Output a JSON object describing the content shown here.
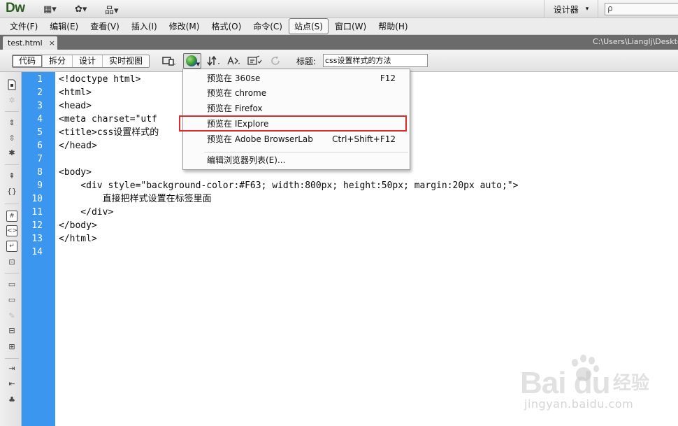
{
  "app": {
    "logo": "Dw",
    "layout_icon": "▦▾",
    "gear_icon": "✿▾",
    "site_icon": "品▾",
    "workspace_label": "设计器",
    "workspace_arrow": "▾",
    "search_glyph": "ρ"
  },
  "menubar": {
    "items": [
      {
        "label": "文件(F)"
      },
      {
        "label": "编辑(E)"
      },
      {
        "label": "查看(V)"
      },
      {
        "label": "插入(I)"
      },
      {
        "label": "修改(M)"
      },
      {
        "label": "格式(O)"
      },
      {
        "label": "命令(C)"
      },
      {
        "label": "站点(S)"
      },
      {
        "label": "窗口(W)"
      },
      {
        "label": "帮助(H)"
      }
    ]
  },
  "tabs": {
    "active": "test.html",
    "close": "×",
    "path": "C:\\Users\\Lianglj\\Deskto"
  },
  "doc_toolbar": {
    "views": [
      "代码",
      "拆分",
      "设计",
      "实时视图"
    ],
    "title_label": "标题:",
    "title_value": "css设置样式的方法"
  },
  "editor": {
    "line_numbers": [
      "1",
      "2",
      "3",
      "4",
      "5",
      "6",
      "7",
      "8",
      "9",
      "10",
      "11",
      "12",
      "13",
      "14"
    ],
    "lines": [
      "<!doctype html>",
      "<html>",
      "<head>",
      "<meta charset=\"utf",
      "<title>css设置样式的",
      "</head>",
      "",
      "<body>",
      "    <div style=\"background-color:#F63; width:800px; height:50px; margin:20px auto;\">",
      "        直接把样式设置在标签里面",
      "    </div>",
      "</body>",
      "</html>",
      ""
    ]
  },
  "preview_menu": {
    "items": [
      {
        "label": "预览在 360se",
        "shortcut": "F12"
      },
      {
        "label": "预览在 chrome",
        "shortcut": ""
      },
      {
        "label": "预览在 Firefox",
        "shortcut": ""
      },
      {
        "label": "预览在 IExplore",
        "shortcut": ""
      },
      {
        "label": "预览在 Adobe BrowserLab",
        "shortcut": "Ctrl+Shift+F12"
      },
      {
        "label": "编辑浏览器列表(E)...",
        "shortcut": ""
      }
    ],
    "highlight_color": "#e0272b"
  },
  "watermark": {
    "brand": "Bai du",
    "cn": "经验",
    "url": "jingyan.baidu.com"
  },
  "colors": {
    "gutter": "#3b96f0",
    "logo": "#2d5d24"
  }
}
